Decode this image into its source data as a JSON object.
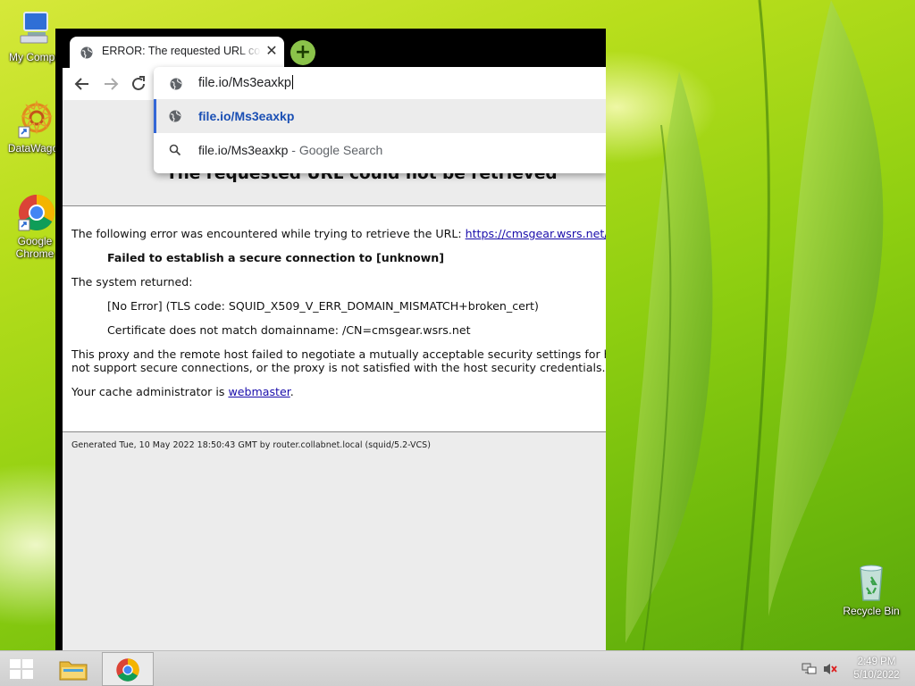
{
  "desktop": {
    "icons": [
      {
        "label": "My Compu",
        "icon": "computer-icon"
      },
      {
        "label": "DataWagor",
        "icon": "datawagon-icon"
      },
      {
        "label": "Google\nChrome",
        "icon": "chrome-icon"
      },
      {
        "label": "Recycle Bin",
        "icon": "recycle-bin-icon"
      }
    ]
  },
  "browser": {
    "tab": {
      "title": "ERROR: The requested URL could not be retrieved",
      "close": "✕"
    },
    "newtab": "+",
    "omnibox": {
      "value": "file.io/Ms3eaxkp",
      "suggestions": [
        {
          "text": "file.io/Ms3eaxkp",
          "suffix": ""
        },
        {
          "text": "file.io/Ms3eaxkp",
          "suffix": " - Google Search"
        }
      ]
    }
  },
  "page": {
    "heading": "The requested URL could not be retrieved",
    "line1_prefix": "The following error was encountered while trying to retrieve the URL: ",
    "line1_link": "https://cmsgear.wsrs.net/*",
    "error_title": "Failed to establish a secure connection to [unknown]",
    "system_returned": "The system returned:",
    "tls_error": "[No Error] (TLS code: SQUID_X509_V_ERR_DOMAIN_MISMATCH+broken_cert)",
    "cert_msg": "Certificate does not match domainname: /CN=cmsgear.wsrs.net",
    "proxy_msg_1": "This proxy and the remote host failed to negotiate a mutually acceptable security settings for hand",
    "proxy_msg_2": "not support secure connections, or the proxy is not satisfied with the host security credentials.",
    "admin_prefix": "Your cache administrator is ",
    "admin_link": "webmaster",
    "admin_suffix": ".",
    "footer": "Generated Tue, 10 May 2022 18:50:43 GMT by router.collabnet.local (squid/5.2-VCS)"
  },
  "taskbar": {
    "time": "2:49 PM",
    "date": "5/10/2022"
  },
  "colors": {
    "accent": "#3367d6",
    "link": "#1a0dab",
    "newtab": "#8bc34a"
  }
}
